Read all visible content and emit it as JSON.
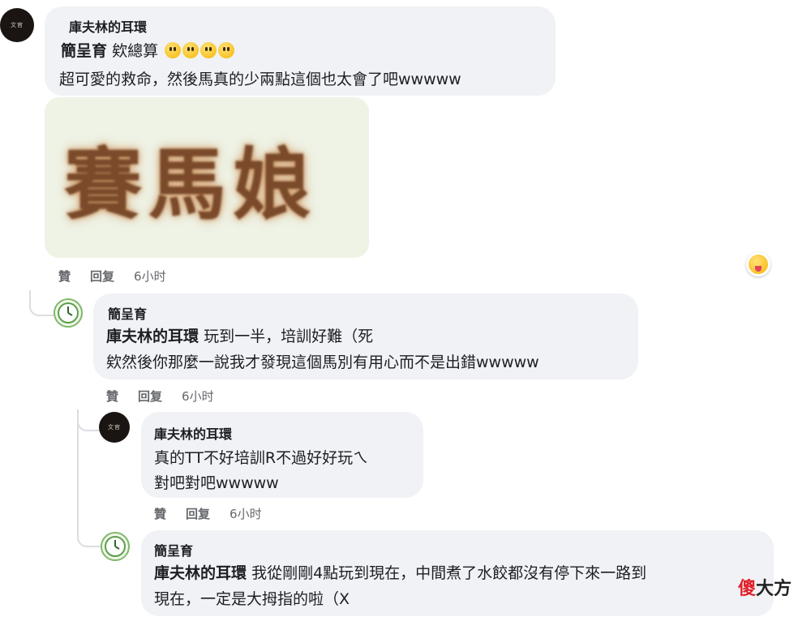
{
  "comment1": {
    "author": "庫夫林的耳環",
    "mention": "簡呈育",
    "line1_text": "欸總算",
    "line2": "超可愛的救命，然後馬真的少兩點這個也太會了吧wwwww",
    "sticker_text": "賽馬娘",
    "actions": {
      "like": "贊",
      "reply": "回复",
      "time": "6小时"
    }
  },
  "reply1": {
    "author": "簡呈育",
    "mention": "庫夫林的耳環",
    "line1_text": "玩到一半，培訓好難（死",
    "line2": "欸然後你那麼一說我才發現這個馬別有用心而不是出錯wwwww",
    "actions": {
      "like": "贊",
      "reply": "回复",
      "time": "6小时"
    }
  },
  "reply2": {
    "author": "庫夫林的耳環",
    "line1": "真的TT不好培訓R不過好好玩ㄟ",
    "line2": "對吧對吧wwwww",
    "actions": {
      "like": "贊",
      "reply": "回复",
      "time": "6小时"
    }
  },
  "reply3": {
    "author": "簡呈育",
    "mention": "庫夫林的耳環",
    "line1_text": "我從剛剛4點玩到現在，中間煮了水餃都沒有停下來一路到",
    "line2": "現在，一定是大拇指的啦（X"
  },
  "watermark": {
    "accent": "傻",
    "rest": "大方"
  },
  "icons": {
    "reaction": "tongue-out-emoji-icon",
    "emoji": "pleading-face-emoji-icon"
  },
  "colors": {
    "bubble": "#f0f2f5",
    "meta": "#65676b",
    "accent": "#e0202a"
  }
}
